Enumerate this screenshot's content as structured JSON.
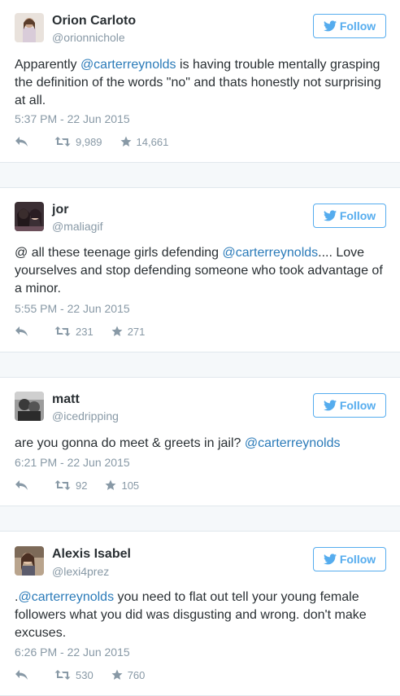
{
  "colors": {
    "accent": "#55acee",
    "link": "#2b7bb9",
    "muted": "#8899a6",
    "text": "#292f33"
  },
  "follow_label": "Follow",
  "tweets": [
    {
      "name": "Orion Carloto",
      "handle": "@orionnichole",
      "text_before": "Apparently ",
      "mention": "@carterreynolds",
      "text_after": " is having trouble mentally grasping the definition of the words \"no\" and thats honestly not surprising at all.",
      "timestamp": "5:37 PM - 22 Jun 2015",
      "retweets": "9,989",
      "favorites": "14,661"
    },
    {
      "name": "jor",
      "handle": "@maliagif",
      "text_before": "@ all these teenage girls defending ",
      "mention": "@carterreynolds",
      "text_after": ".... Love yourselves and stop defending someone who took advantage of a minor.",
      "timestamp": "5:55 PM - 22 Jun 2015",
      "retweets": "231",
      "favorites": "271"
    },
    {
      "name": "matt",
      "handle": "@icedripping",
      "text_before": "are you gonna do meet & greets in jail? ",
      "mention": "@carterreynolds",
      "text_after": "",
      "timestamp": "6:21 PM - 22 Jun 2015",
      "retweets": "92",
      "favorites": "105"
    },
    {
      "name": "Alexis Isabel",
      "handle": "@lexi4prez",
      "text_before": ".",
      "mention": "@carterreynolds",
      "text_after": " you need to flat out tell your young female followers what you did was disgusting and wrong. don't make excuses.",
      "timestamp": "6:26 PM - 22 Jun 2015",
      "retweets": "530",
      "favorites": "760"
    }
  ]
}
